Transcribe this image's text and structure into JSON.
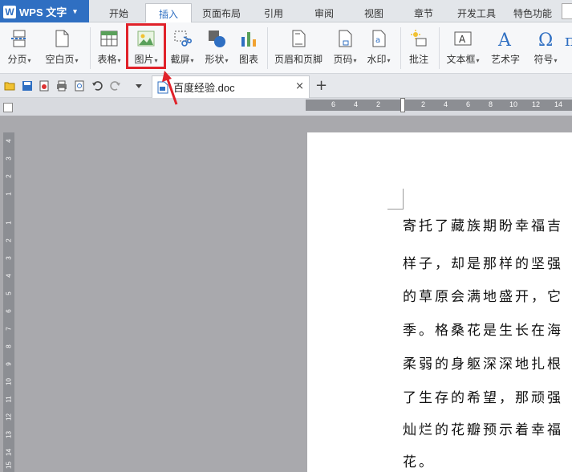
{
  "app": {
    "name": "WPS 文字",
    "menu_caret": "▾"
  },
  "tabs": [
    {
      "label": "开始"
    },
    {
      "label": "插入"
    },
    {
      "label": "页面布局"
    },
    {
      "label": "引用"
    },
    {
      "label": "审阅"
    },
    {
      "label": "视图"
    },
    {
      "label": "章节"
    },
    {
      "label": "开发工具"
    },
    {
      "label": "特色功能"
    }
  ],
  "active_tab": "插入",
  "ribbon": {
    "page_break": "分页",
    "blank_page": "空白页",
    "table": "表格",
    "picture": "图片",
    "screenshot": "截屏",
    "shapes": "形状",
    "chart": "图表",
    "header_footer": "页眉和页脚",
    "page_number": "页码",
    "watermark": "水印",
    "comment": "批注",
    "textbox": "文本框",
    "wordart": "艺术字",
    "symbol": "符号",
    "dropdown_glyph": "▾"
  },
  "document_tab": {
    "name": "百度经验.doc",
    "close": "×",
    "add": "+"
  },
  "ruler": {
    "h_ticks": [
      "6",
      "4",
      "2",
      "2",
      "4",
      "6",
      "8",
      "10",
      "12",
      "14"
    ],
    "v_ticks": [
      "4",
      "3",
      "2",
      "1",
      "1",
      "2",
      "3",
      "4",
      "5",
      "6",
      "7",
      "8",
      "9",
      "10",
      "11",
      "12",
      "13",
      "14",
      "15",
      "16"
    ]
  },
  "document": {
    "lines": [
      "寄托了藏族期盼幸福吉",
      "样子，却是那样的坚强",
      "的草原会满地盛开，它",
      "季。格桑花是生长在海",
      "柔弱的身躯深深地扎根",
      "了生存的希望，那顽强",
      "灿烂的花瓣预示着幸福",
      "花。"
    ]
  },
  "colors": {
    "brand": "#2f6fc2",
    "highlight": "#e0222a",
    "ruler": "#8c8e93",
    "workspace": "#a9a9ad"
  }
}
